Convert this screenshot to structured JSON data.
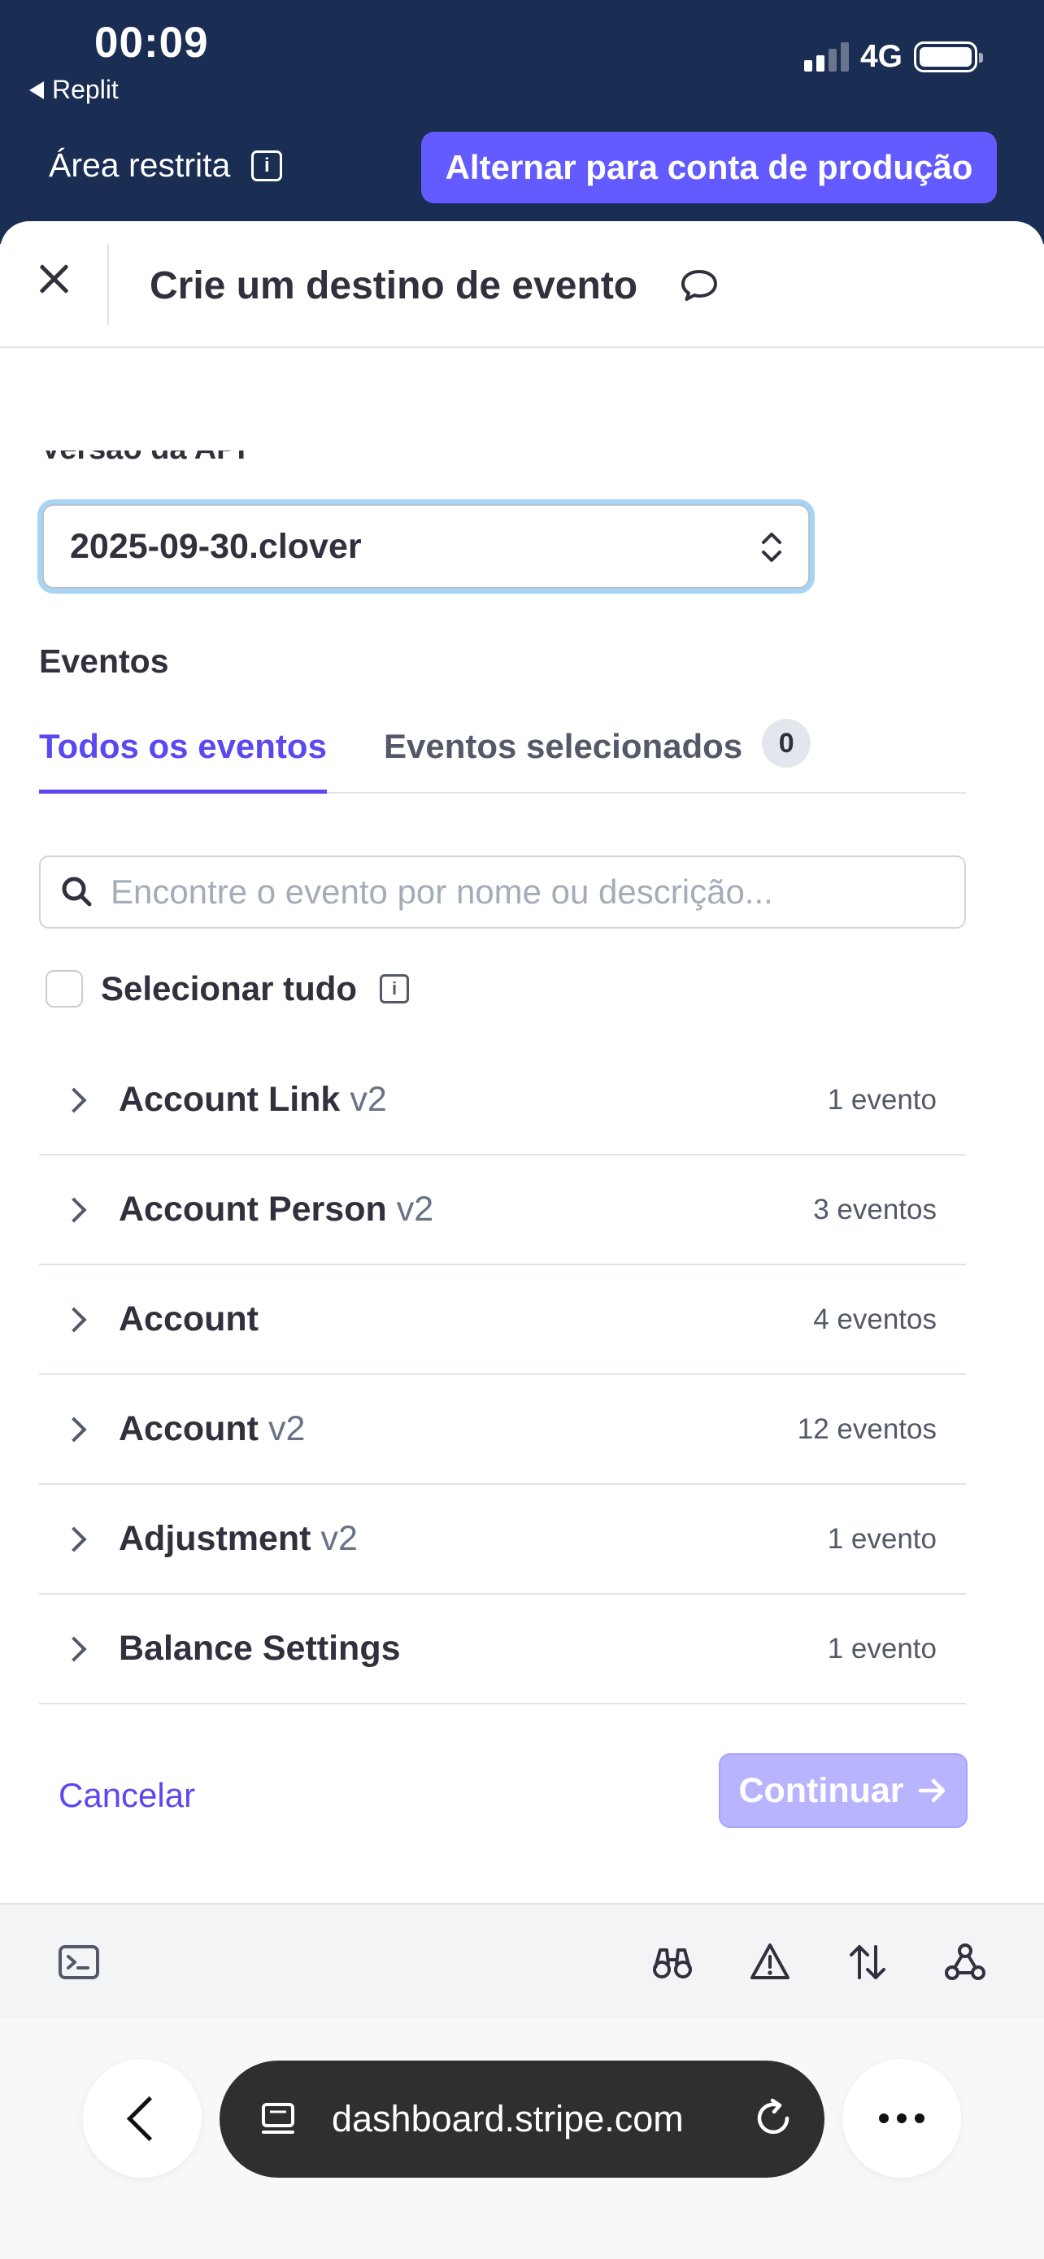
{
  "status_bar": {
    "time": "00:09",
    "back_app": "Replit",
    "network": "4G"
  },
  "top_banner": {
    "sandbox_label": "Área restrita",
    "switch_button": "Alternar para conta de produção"
  },
  "sheet": {
    "title": "Crie um destino de evento",
    "api_version_label": "Versão da API",
    "api_version_value": "2025-09-30.clover",
    "events_label": "Eventos",
    "tabs": {
      "all": "Todos os eventos",
      "selected": "Eventos selecionados",
      "selected_count": "0"
    },
    "search_placeholder": "Encontre o evento por nome ou descrição...",
    "select_all": "Selecionar tudo",
    "events": [
      {
        "name": "Account Link",
        "version": "v2",
        "count": "1 evento"
      },
      {
        "name": "Account Person",
        "version": "v2",
        "count": "3 eventos"
      },
      {
        "name": "Account",
        "version": "",
        "count": "4 eventos"
      },
      {
        "name": "Account",
        "version": "v2",
        "count": "12 eventos"
      },
      {
        "name": "Adjustment",
        "version": "v2",
        "count": "1 evento"
      },
      {
        "name": "Balance Settings",
        "version": "",
        "count": "1 evento"
      }
    ],
    "cancel": "Cancelar",
    "continue": "Continuar"
  },
  "browser": {
    "url": "dashboard.stripe.com"
  },
  "colors": {
    "header_bg": "#1a2d52",
    "accent": "#635bff",
    "link": "#5a48f0",
    "continue_disabled": "#b9b4ff"
  }
}
